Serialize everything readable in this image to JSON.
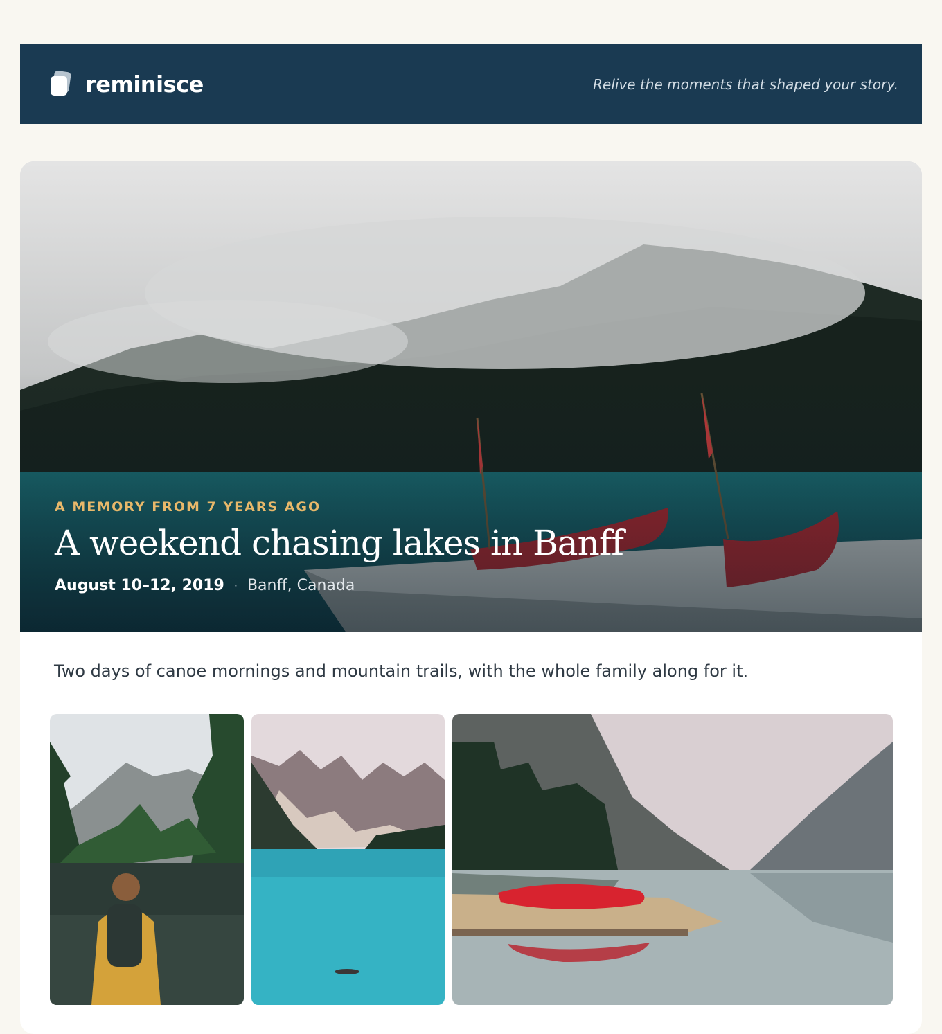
{
  "header": {
    "brand_name": "reminisce",
    "tagline": "Relive the moments that shaped your story."
  },
  "memory": {
    "eyebrow": "A MEMORY FROM 7 YEARS AGO",
    "title": "A weekend chasing lakes in Banff",
    "date": "August 10–12, 2019",
    "separator": "·",
    "location": "Banff, Canada",
    "summary": "Two days of canoe mornings and mountain trails, with the whole family along for it."
  },
  "colors": {
    "header_bg": "#1a3a52",
    "page_bg": "#f9f7f1",
    "eyebrow_accent": "#e8b86a"
  },
  "icons": {
    "logo": "stacked-cards-icon"
  }
}
